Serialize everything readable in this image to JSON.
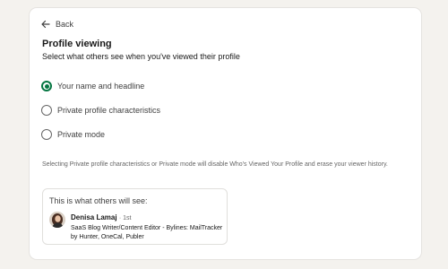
{
  "header": {
    "back_label": "Back",
    "title": "Profile viewing",
    "subtitle": "Select what others see when you've viewed their profile"
  },
  "options": [
    {
      "label": "Your name and headline",
      "selected": true
    },
    {
      "label": "Private profile characteristics",
      "selected": false
    },
    {
      "label": "Private mode",
      "selected": false
    }
  ],
  "note": "Selecting Private profile characteristics or Private mode will disable Who's Viewed Your Profile and erase your viewer history.",
  "preview": {
    "heading": "This is what others will see:",
    "name": "Denisa Lamaj",
    "degree": "· 1st",
    "headline": "SaaS Blog Writer/Content Editor - Bylines: MailTracker by Hunter, OneCal, Publer"
  },
  "colors": {
    "accent": "#057642",
    "page_background": "#f4f2ee",
    "card_background": "#ffffff"
  }
}
